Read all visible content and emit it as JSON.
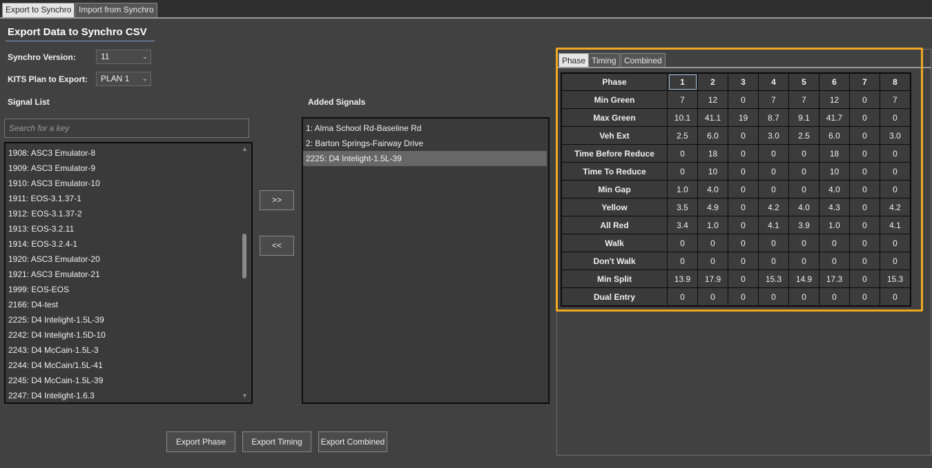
{
  "top_tabs": [
    {
      "label": "Export to Synchro",
      "active": true
    },
    {
      "label": "Import from Synchro",
      "active": false
    }
  ],
  "heading": "Export Data to Synchro CSV",
  "form": {
    "version_label": "Synchro Version:",
    "version_value": "11",
    "plan_label": "KITS Plan to Export:",
    "plan_value": "PLAN 1"
  },
  "signal_list": {
    "label": "Signal List",
    "search_placeholder": "Search for a key",
    "items": [
      "1908: ASC3 Emulator-8",
      "1909: ASC3 Emulator-9",
      "1910: ASC3 Emulator-10",
      "1911: EOS-3.1.37-1",
      "1912: EOS-3.1.37-2",
      "1913: EOS-3.2.11",
      "1914: EOS-3.2.4-1",
      "1920: ASC3 Emulator-20",
      "1921: ASC3 Emulator-21",
      "1999: EOS-EOS",
      "2166: D4-test",
      "2225: D4 Intelight-1.5L-39",
      "2242: D4 Intelight-1.5D-10",
      "2243: D4 McCain-1.5L-3",
      "2244: D4 McCain/1.5L-41",
      "2245: D4 McCain-1.5L-39",
      "2247: D4 Intelight-1.6.3"
    ]
  },
  "transfer": {
    "add_label": ">>",
    "remove_label": "<<"
  },
  "added_signals": {
    "label": "Added Signals",
    "items": [
      "1: Alma School Rd-Baseline Rd",
      "2: Barton Springs-Fairway Drive",
      "2225: D4 Intelight-1.5L-39"
    ],
    "selected_index": 2
  },
  "buttons": {
    "export_phase": "Export Phase",
    "export_timing": "Export Timing",
    "export_combined": "Export Combined"
  },
  "sub_tabs": [
    {
      "label": "Phase",
      "active": true
    },
    {
      "label": "Timing",
      "active": false
    },
    {
      "label": "Combined",
      "active": false
    }
  ],
  "phase_table": {
    "header_label": "Phase",
    "columns": [
      "1",
      "2",
      "3",
      "4",
      "5",
      "6",
      "7",
      "8"
    ],
    "rows": [
      {
        "label": "Min Green",
        "values": [
          "7",
          "12",
          "0",
          "7",
          "7",
          "12",
          "0",
          "7"
        ]
      },
      {
        "label": "Max Green",
        "values": [
          "10.1",
          "41.1",
          "19",
          "8.7",
          "9.1",
          "41.7",
          "0",
          "0"
        ]
      },
      {
        "label": "Veh Ext",
        "values": [
          "2.5",
          "6.0",
          "0",
          "3.0",
          "2.5",
          "6.0",
          "0",
          "3.0"
        ]
      },
      {
        "label": "Time Before Reduce",
        "values": [
          "0",
          "18",
          "0",
          "0",
          "0",
          "18",
          "0",
          "0"
        ]
      },
      {
        "label": "Time To Reduce",
        "values": [
          "0",
          "10",
          "0",
          "0",
          "0",
          "10",
          "0",
          "0"
        ]
      },
      {
        "label": "Min Gap",
        "values": [
          "1.0",
          "4.0",
          "0",
          "0",
          "0",
          "4.0",
          "0",
          "0"
        ]
      },
      {
        "label": "Yellow",
        "values": [
          "3.5",
          "4.9",
          "0",
          "4.2",
          "4.0",
          "4.3",
          "0",
          "4.2"
        ]
      },
      {
        "label": "All Red",
        "values": [
          "3.4",
          "1.0",
          "0",
          "4.1",
          "3.9",
          "1.0",
          "0",
          "4.1"
        ]
      },
      {
        "label": "Walk",
        "values": [
          "0",
          "0",
          "0",
          "0",
          "0",
          "0",
          "0",
          "0"
        ]
      },
      {
        "label": "Don't Walk",
        "values": [
          "0",
          "0",
          "0",
          "0",
          "0",
          "0",
          "0",
          "0"
        ]
      },
      {
        "label": "Min Split",
        "values": [
          "13.9",
          "17.9",
          "0",
          "15.3",
          "14.9",
          "17.3",
          "0",
          "15.3"
        ]
      },
      {
        "label": "Dual Entry",
        "values": [
          "0",
          "0",
          "0",
          "0",
          "0",
          "0",
          "0",
          "0"
        ]
      }
    ]
  },
  "colors": {
    "highlight": "#f0a81e",
    "background": "#414141"
  }
}
